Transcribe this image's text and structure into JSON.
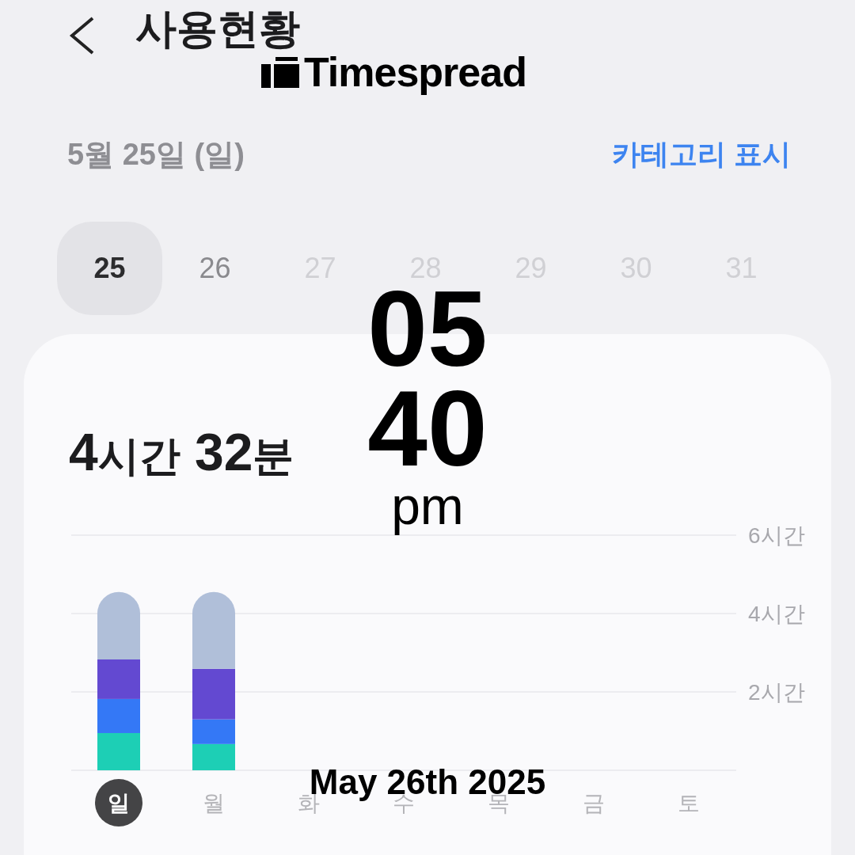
{
  "header": {
    "title": "사용현황"
  },
  "overlay": {
    "logo_text": "Timespread",
    "hour": "05",
    "minute": "40",
    "meridiem": "pm",
    "date": "May 26th 2025"
  },
  "date_label": "5월 25일 (일)",
  "category_link": "카테고리 표시",
  "dates": [
    {
      "label": "25",
      "selected": true,
      "disabled": false
    },
    {
      "label": "26",
      "selected": false,
      "disabled": false
    },
    {
      "label": "27",
      "selected": false,
      "disabled": true
    },
    {
      "label": "28",
      "selected": false,
      "disabled": true
    },
    {
      "label": "29",
      "selected": false,
      "disabled": true
    },
    {
      "label": "30",
      "selected": false,
      "disabled": true
    },
    {
      "label": "31",
      "selected": false,
      "disabled": true
    }
  ],
  "total": {
    "hours": "4",
    "hours_unit": "시간",
    "minutes": "32",
    "minutes_unit": "분"
  },
  "day_tabs": [
    {
      "selected": true
    },
    {
      "selected": false
    },
    {
      "selected": false
    },
    {
      "selected": false
    },
    {
      "selected": false
    },
    {
      "selected": false
    },
    {
      "selected": false
    }
  ],
  "chart_data": {
    "type": "bar",
    "stacked": true,
    "categories": [
      "일",
      "월",
      "화",
      "수",
      "목",
      "금",
      "토"
    ],
    "ylim": [
      0,
      6
    ],
    "yticks": [
      {
        "value": 2,
        "label": "2시간"
      },
      {
        "value": 4,
        "label": "4시간"
      },
      {
        "value": 6,
        "label": "6시간"
      }
    ],
    "series": [
      {
        "color": "#1dcfb5",
        "values": [
          0.95,
          0.67,
          null,
          null,
          null,
          null,
          null
        ]
      },
      {
        "color": "#3478f6",
        "values": [
          0.87,
          0.63,
          null,
          null,
          null,
          null,
          null
        ]
      },
      {
        "color": "#6349d1",
        "values": [
          1.01,
          1.29,
          null,
          null,
          null,
          null,
          null
        ]
      },
      {
        "color": "#b0bfd9",
        "values": [
          1.72,
          1.96,
          null,
          null,
          null,
          null,
          null
        ]
      }
    ]
  }
}
